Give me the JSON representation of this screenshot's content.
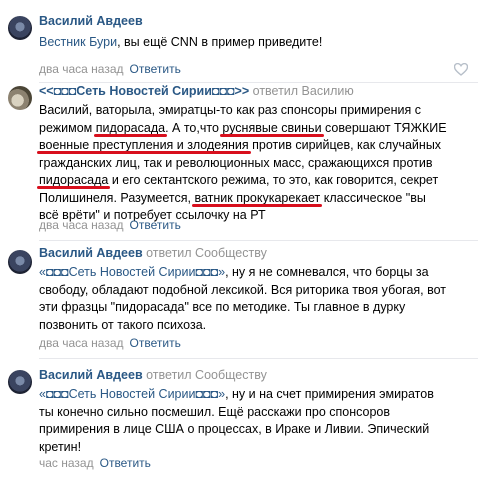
{
  "comments": [
    {
      "author": "Василий Авдеев",
      "reply_to": "",
      "lines": [
        [
          {
            "t": "Вестник Бури",
            "link": true
          },
          {
            "t": ", вы ещё CNN в пример приведите!"
          }
        ]
      ],
      "time": "два часа назад",
      "reply_label": "Ответить"
    },
    {
      "author": "<<◘◘◘Сеть Новостей Сирии◘◘◘>>",
      "reply_to": "ответил Василию",
      "lines": [
        [
          {
            "t": "Василий, ваторыла, эмиратцы-то как раз спонсоры примирения с"
          }
        ],
        [
          {
            "t": "режимом "
          },
          {
            "t": "пидорасада",
            "u": true
          },
          {
            "t": ". А то,что "
          },
          {
            "t": "руснявые свиньи",
            "u": true
          },
          {
            "t": " совершают ТЯЖКИЕ"
          }
        ],
        [
          {
            "t": "военные преступления и злодеяния",
            "u": true
          },
          {
            "t": " против сирийцев, как случайных"
          }
        ],
        [
          {
            "t": "гражданских лиц, так и революционных масс, сражающихся против"
          }
        ],
        [
          {
            "t": "пидорасада",
            "u": true
          },
          {
            "t": " и его сектантского режима, то это, как говорится, секрет"
          }
        ],
        [
          {
            "t": "Полишинеля. Разумеется, "
          },
          {
            "t": "ватник прокукарекает",
            "u": true
          },
          {
            "t": " классическое \"вы"
          }
        ],
        [
          {
            "t": "всё врёти\" и потребует ссылочку на РТ"
          }
        ]
      ],
      "time": "два часа назад",
      "reply_label": "Ответить"
    },
    {
      "author": "Василий Авдеев",
      "reply_to": "ответил Сообществу",
      "lines": [
        [
          {
            "t": "«◘◘◘Сеть Новостей Сирии◘◘◘»",
            "link": true
          },
          {
            "t": ", ну я не сомневался, что борцы за"
          }
        ],
        [
          {
            "t": "свободу, обладают подобной лексикой. Вся риторика твоя убогая, вот"
          }
        ],
        [
          {
            "t": "эти фразцы \"пидорасада\" все по методике. Ты главное в дурку"
          }
        ],
        [
          {
            "t": "позвонить от такого психоза."
          }
        ]
      ],
      "time": "два часа назад",
      "reply_label": "Ответить"
    },
    {
      "author": "Василий Авдеев",
      "reply_to": "ответил Сообществу",
      "lines": [
        [
          {
            "t": "«◘◘◘Сеть Новостей Сирии◘◘◘»",
            "link": true
          },
          {
            "t": ", ну и на счет примирения эмиратов"
          }
        ],
        [
          {
            "t": "ты конечно сильно посмешил. Ещё расскажи про спонсоров"
          }
        ],
        [
          {
            "t": "примирения в лице США о процессах, в Ираке и Ливии. Эпический"
          }
        ],
        [
          {
            "t": "кретин!"
          }
        ]
      ],
      "time": "час назад",
      "reply_label": "Ответить"
    }
  ],
  "colors": {
    "link": "#2a5885",
    "meta": "#939393",
    "underline": "#d80f1d"
  },
  "icons": [
    "heart-icon"
  ]
}
